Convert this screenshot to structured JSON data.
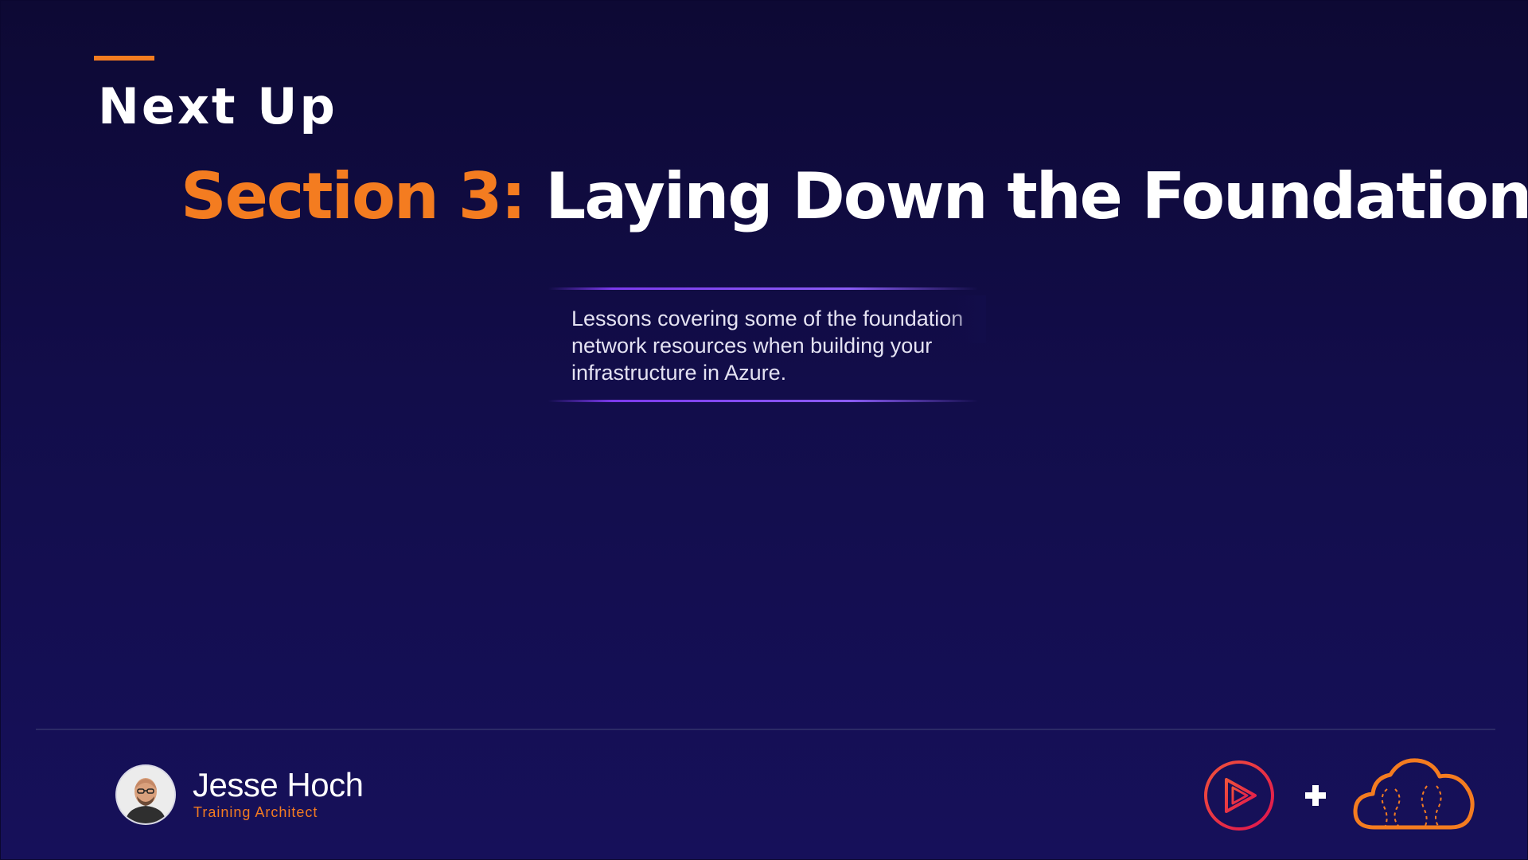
{
  "slide": {
    "heading": "Next Up",
    "section_label": "Section 3:",
    "section_name": "Laying Down the Foundation",
    "description": "Lessons covering some of the foundation\nnetwork resources when building your\ninfrastructure in Azure."
  },
  "presenter": {
    "name": "Jesse Hoch",
    "role": "Training Architect"
  },
  "icons": {
    "play_logo": "play-circle-icon",
    "plus": "plus-icon",
    "cloud_logo": "cloud-icon"
  },
  "colors": {
    "accent": "#f47c20",
    "background": "#120d4a",
    "divider_purple": "#7c3aed",
    "play_logo": "#e8274b"
  }
}
